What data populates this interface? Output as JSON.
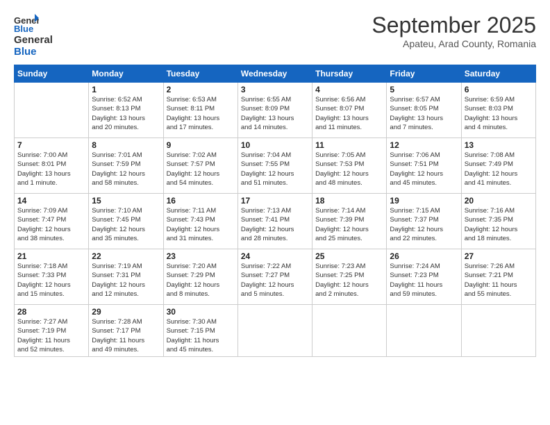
{
  "header": {
    "logo_general": "General",
    "logo_blue": "Blue",
    "month": "September 2025",
    "location": "Apateu, Arad County, Romania"
  },
  "days_of_week": [
    "Sunday",
    "Monday",
    "Tuesday",
    "Wednesday",
    "Thursday",
    "Friday",
    "Saturday"
  ],
  "weeks": [
    [
      {
        "day": "",
        "info": ""
      },
      {
        "day": "1",
        "info": "Sunrise: 6:52 AM\nSunset: 8:13 PM\nDaylight: 13 hours\nand 20 minutes."
      },
      {
        "day": "2",
        "info": "Sunrise: 6:53 AM\nSunset: 8:11 PM\nDaylight: 13 hours\nand 17 minutes."
      },
      {
        "day": "3",
        "info": "Sunrise: 6:55 AM\nSunset: 8:09 PM\nDaylight: 13 hours\nand 14 minutes."
      },
      {
        "day": "4",
        "info": "Sunrise: 6:56 AM\nSunset: 8:07 PM\nDaylight: 13 hours\nand 11 minutes."
      },
      {
        "day": "5",
        "info": "Sunrise: 6:57 AM\nSunset: 8:05 PM\nDaylight: 13 hours\nand 7 minutes."
      },
      {
        "day": "6",
        "info": "Sunrise: 6:59 AM\nSunset: 8:03 PM\nDaylight: 13 hours\nand 4 minutes."
      }
    ],
    [
      {
        "day": "7",
        "info": "Sunrise: 7:00 AM\nSunset: 8:01 PM\nDaylight: 13 hours\nand 1 minute."
      },
      {
        "day": "8",
        "info": "Sunrise: 7:01 AM\nSunset: 7:59 PM\nDaylight: 12 hours\nand 58 minutes."
      },
      {
        "day": "9",
        "info": "Sunrise: 7:02 AM\nSunset: 7:57 PM\nDaylight: 12 hours\nand 54 minutes."
      },
      {
        "day": "10",
        "info": "Sunrise: 7:04 AM\nSunset: 7:55 PM\nDaylight: 12 hours\nand 51 minutes."
      },
      {
        "day": "11",
        "info": "Sunrise: 7:05 AM\nSunset: 7:53 PM\nDaylight: 12 hours\nand 48 minutes."
      },
      {
        "day": "12",
        "info": "Sunrise: 7:06 AM\nSunset: 7:51 PM\nDaylight: 12 hours\nand 45 minutes."
      },
      {
        "day": "13",
        "info": "Sunrise: 7:08 AM\nSunset: 7:49 PM\nDaylight: 12 hours\nand 41 minutes."
      }
    ],
    [
      {
        "day": "14",
        "info": "Sunrise: 7:09 AM\nSunset: 7:47 PM\nDaylight: 12 hours\nand 38 minutes."
      },
      {
        "day": "15",
        "info": "Sunrise: 7:10 AM\nSunset: 7:45 PM\nDaylight: 12 hours\nand 35 minutes."
      },
      {
        "day": "16",
        "info": "Sunrise: 7:11 AM\nSunset: 7:43 PM\nDaylight: 12 hours\nand 31 minutes."
      },
      {
        "day": "17",
        "info": "Sunrise: 7:13 AM\nSunset: 7:41 PM\nDaylight: 12 hours\nand 28 minutes."
      },
      {
        "day": "18",
        "info": "Sunrise: 7:14 AM\nSunset: 7:39 PM\nDaylight: 12 hours\nand 25 minutes."
      },
      {
        "day": "19",
        "info": "Sunrise: 7:15 AM\nSunset: 7:37 PM\nDaylight: 12 hours\nand 22 minutes."
      },
      {
        "day": "20",
        "info": "Sunrise: 7:16 AM\nSunset: 7:35 PM\nDaylight: 12 hours\nand 18 minutes."
      }
    ],
    [
      {
        "day": "21",
        "info": "Sunrise: 7:18 AM\nSunset: 7:33 PM\nDaylight: 12 hours\nand 15 minutes."
      },
      {
        "day": "22",
        "info": "Sunrise: 7:19 AM\nSunset: 7:31 PM\nDaylight: 12 hours\nand 12 minutes."
      },
      {
        "day": "23",
        "info": "Sunrise: 7:20 AM\nSunset: 7:29 PM\nDaylight: 12 hours\nand 8 minutes."
      },
      {
        "day": "24",
        "info": "Sunrise: 7:22 AM\nSunset: 7:27 PM\nDaylight: 12 hours\nand 5 minutes."
      },
      {
        "day": "25",
        "info": "Sunrise: 7:23 AM\nSunset: 7:25 PM\nDaylight: 12 hours\nand 2 minutes."
      },
      {
        "day": "26",
        "info": "Sunrise: 7:24 AM\nSunset: 7:23 PM\nDaylight: 11 hours\nand 59 minutes."
      },
      {
        "day": "27",
        "info": "Sunrise: 7:26 AM\nSunset: 7:21 PM\nDaylight: 11 hours\nand 55 minutes."
      }
    ],
    [
      {
        "day": "28",
        "info": "Sunrise: 7:27 AM\nSunset: 7:19 PM\nDaylight: 11 hours\nand 52 minutes."
      },
      {
        "day": "29",
        "info": "Sunrise: 7:28 AM\nSunset: 7:17 PM\nDaylight: 11 hours\nand 49 minutes."
      },
      {
        "day": "30",
        "info": "Sunrise: 7:30 AM\nSunset: 7:15 PM\nDaylight: 11 hours\nand 45 minutes."
      },
      {
        "day": "",
        "info": ""
      },
      {
        "day": "",
        "info": ""
      },
      {
        "day": "",
        "info": ""
      },
      {
        "day": "",
        "info": ""
      }
    ]
  ]
}
